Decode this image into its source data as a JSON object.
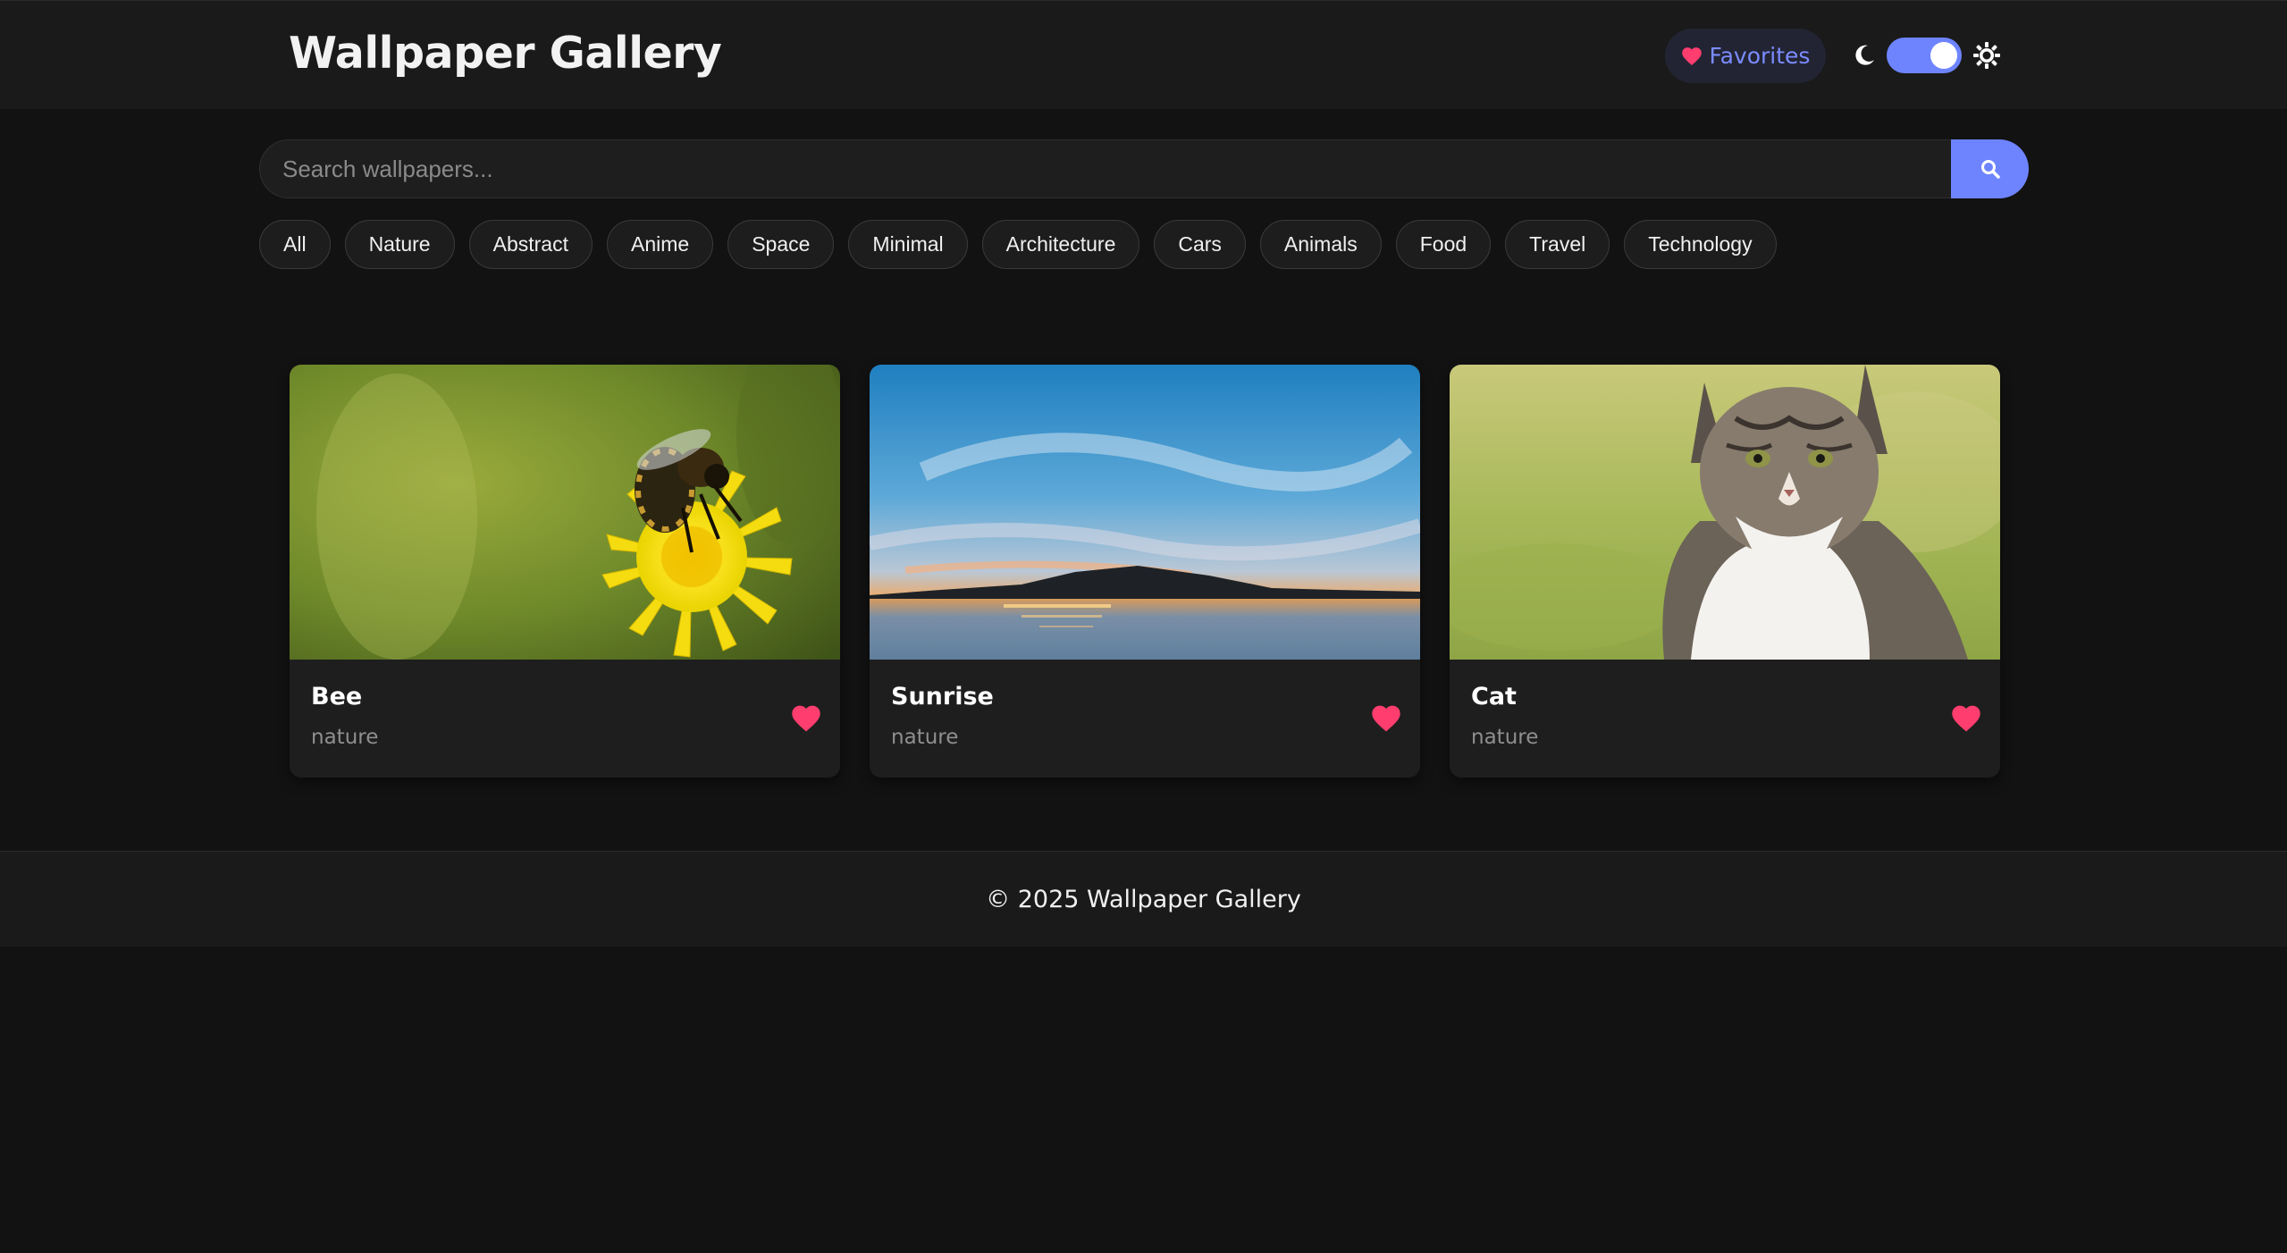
{
  "header": {
    "title": "Wallpaper Gallery",
    "favorites_label": "Favorites",
    "theme_toggle": "dark"
  },
  "search": {
    "placeholder": "Search wallpapers...",
    "value": ""
  },
  "categories": [
    "All",
    "Nature",
    "Abstract",
    "Anime",
    "Space",
    "Minimal",
    "Architecture",
    "Cars",
    "Animals",
    "Food",
    "Travel",
    "Technology"
  ],
  "wallpapers": [
    {
      "title": "Bee",
      "category": "nature",
      "image": "bee on yellow dandelion"
    },
    {
      "title": "Sunrise",
      "category": "nature",
      "image": "sunrise over lake"
    },
    {
      "title": "Cat",
      "category": "nature",
      "image": "tabby cat on grass"
    }
  ],
  "footer": {
    "text": "© 2025 Wallpaper Gallery"
  },
  "colors": {
    "accent": "#6e84ff",
    "heart": "#ff3d6e",
    "background": "#121212",
    "surface": "#1e1e1e"
  },
  "icons": [
    "heart-icon",
    "moon-icon",
    "sun-icon",
    "search-icon"
  ]
}
